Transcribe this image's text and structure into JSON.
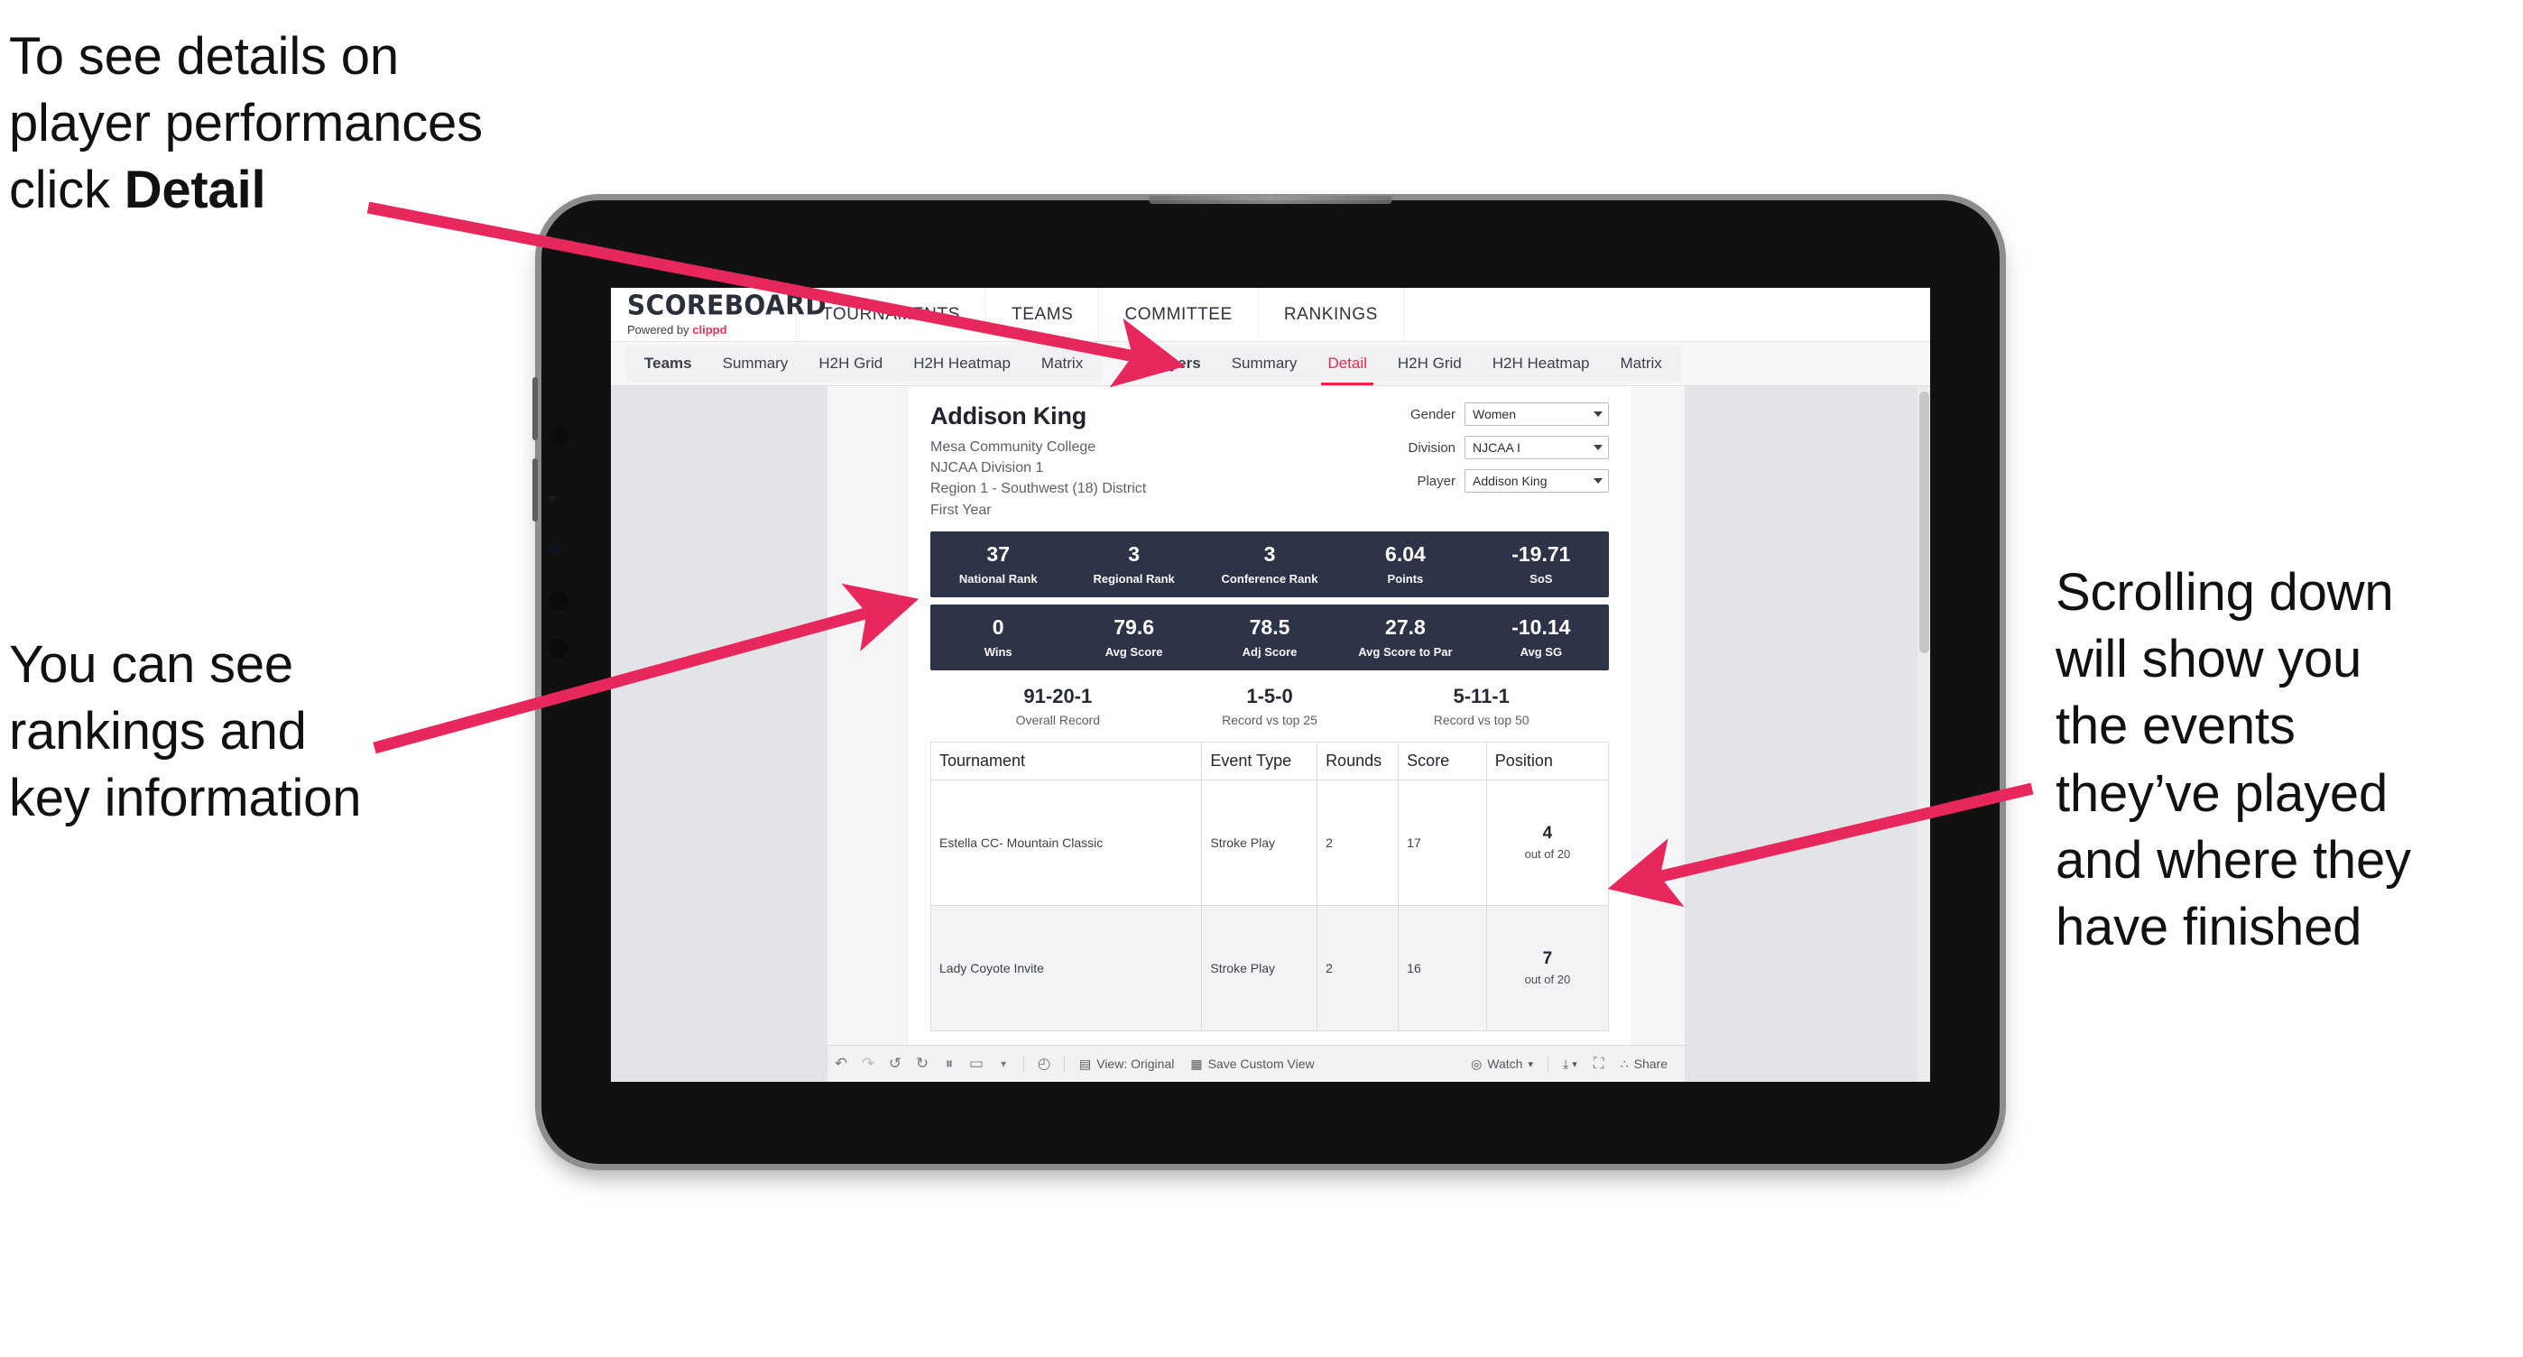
{
  "annotations": {
    "callout_1": {
      "line1": "To see details on",
      "line2": "player performances",
      "line3_pre": "click ",
      "line3_bold": "Detail"
    },
    "callout_2": {
      "line1": "You can see",
      "line2": "rankings and",
      "line3": "key information"
    },
    "callout_3": {
      "line1": "Scrolling down",
      "line2": "will show you",
      "line3": "the events",
      "line4": "they’ve played",
      "line5": "and where they",
      "line6": "have finished"
    },
    "arrow_color": "#e8275c"
  },
  "app": {
    "brand": {
      "title": "SCOREBOARD",
      "powered_prefix": "Powered by ",
      "powered_name": "clippd"
    },
    "topnav": [
      "TOURNAMENTS",
      "TEAMS",
      "COMMITTEE",
      "RANKINGS"
    ],
    "subnav_group_1": [
      "Teams",
      "Summary",
      "H2H Grid",
      "H2H Heatmap",
      "Matrix"
    ],
    "subnav_group_2": [
      "Players",
      "Summary",
      "Detail",
      "H2H Grid",
      "H2H Heatmap",
      "Matrix"
    ],
    "subnav_active": "Detail"
  },
  "player": {
    "name": "Addison King",
    "school": "Mesa Community College",
    "division": "NJCAA Division 1",
    "region": "Region 1 - Southwest (18) District",
    "year": "First Year"
  },
  "filters": [
    {
      "label": "Gender",
      "value": "Women"
    },
    {
      "label": "Division",
      "value": "NJCAA I"
    },
    {
      "label": "Player",
      "value": "Addison King"
    }
  ],
  "stats_row_1": [
    {
      "value": "37",
      "label": "National Rank"
    },
    {
      "value": "3",
      "label": "Regional Rank"
    },
    {
      "value": "3",
      "label": "Conference Rank"
    },
    {
      "value": "6.04",
      "label": "Points"
    },
    {
      "value": "-19.71",
      "label": "SoS"
    }
  ],
  "stats_row_2": [
    {
      "value": "0",
      "label": "Wins"
    },
    {
      "value": "79.6",
      "label": "Avg Score"
    },
    {
      "value": "78.5",
      "label": "Adj Score"
    },
    {
      "value": "27.8",
      "label": "Avg Score to Par"
    },
    {
      "value": "-10.14",
      "label": "Avg SG"
    }
  ],
  "records": [
    {
      "value": "91-20-1",
      "label": "Overall Record"
    },
    {
      "value": "1-5-0",
      "label": "Record vs top 25"
    },
    {
      "value": "5-11-1",
      "label": "Record vs top 50"
    }
  ],
  "events_table": {
    "columns": [
      "Tournament",
      "Event Type",
      "Rounds",
      "Score",
      "Position"
    ],
    "rows": [
      {
        "tournament": "Estella CC- Mountain Classic",
        "event_type": "Stroke Play",
        "rounds": "2",
        "score": "17",
        "position": "4",
        "position_out_of": "out of 20"
      },
      {
        "tournament": "Lady Coyote Invite",
        "event_type": "Stroke Play",
        "rounds": "2",
        "score": "16",
        "position": "7",
        "position_out_of": "out of 20"
      }
    ]
  },
  "toolbar": {
    "undo_icon": "↶",
    "redo_icon": "↷",
    "revert_icon": "↺",
    "refresh_icon": "↻",
    "pause_icon": "⏸",
    "loop_icon": "▭",
    "caret_icon": "▾",
    "slow_icon": "◴",
    "view_icon": "▤",
    "view_label": "View: Original",
    "save_icon": "▦",
    "save_label": "Save Custom View",
    "watch_icon": "◎",
    "watch_label": "Watch",
    "download_icon": "⤓",
    "fullscreen_icon": "⛶",
    "share_icon": "∴",
    "share_label": "Share"
  },
  "colors": {
    "accent_pink": "#e8275c",
    "stat_navy": "#2e3448",
    "brand_red": "#f0325c"
  }
}
